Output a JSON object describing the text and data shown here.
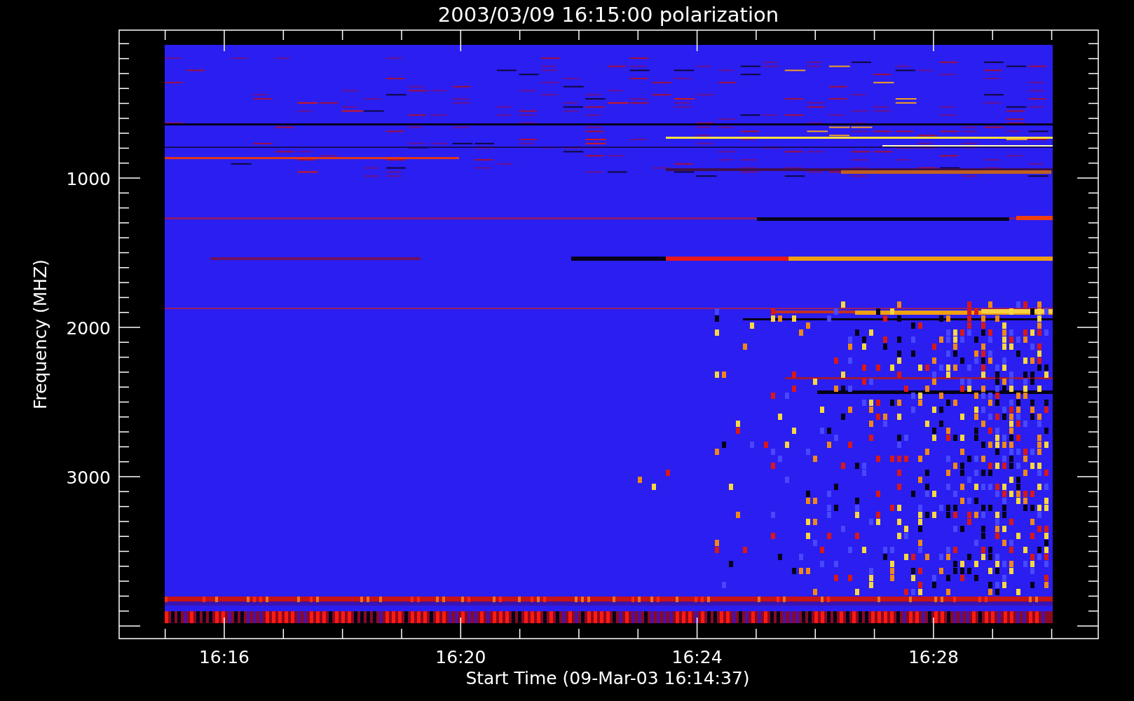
{
  "title": "2003/03/09 16:15:00 polarization",
  "y_axis": {
    "label": "Frequency (MHZ)",
    "tick_labels": [
      "1000",
      "2000",
      "3000"
    ]
  },
  "x_axis": {
    "label": "Start Time (09-Mar-03 16:14:37)",
    "tick_labels": [
      "16:16",
      "16:20",
      "16:24",
      "16:28"
    ]
  }
}
